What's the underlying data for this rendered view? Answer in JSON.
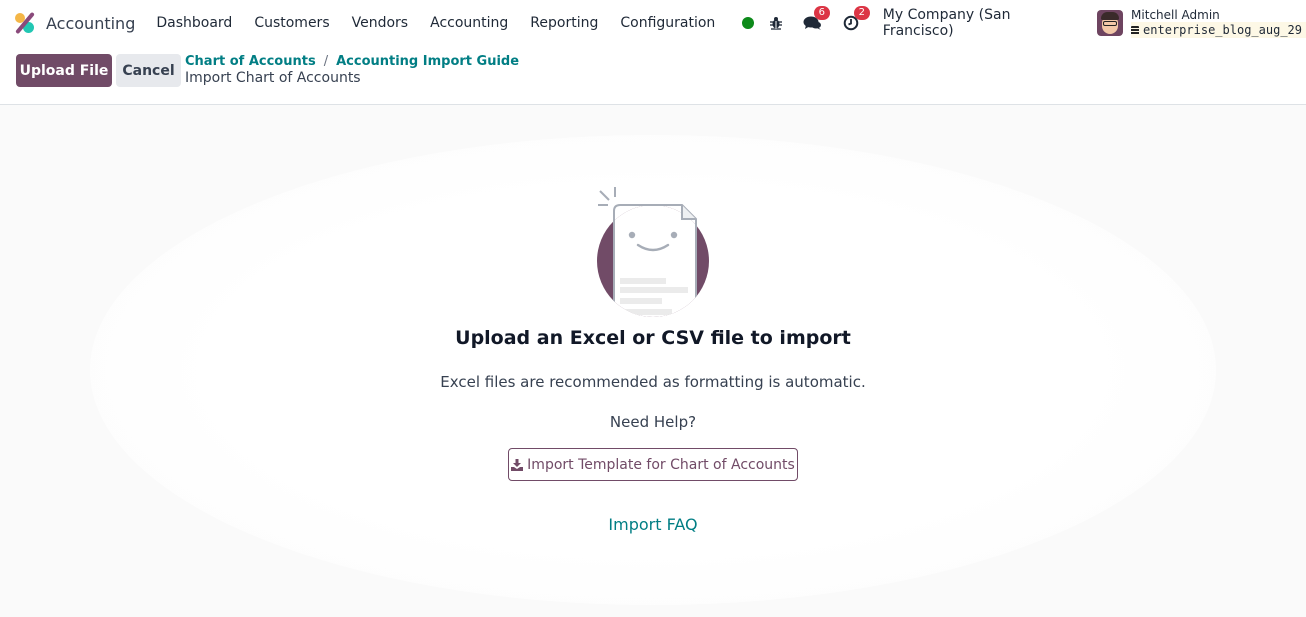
{
  "navbar": {
    "app_name": "Accounting",
    "menu": [
      "Dashboard",
      "Customers",
      "Vendors",
      "Accounting",
      "Reporting",
      "Configuration"
    ],
    "messages_count": "6",
    "activities_count": "2",
    "company": "My Company (San Francisco)",
    "user_name": "Mitchell Admin",
    "database": "enterprise_blog_aug_29",
    "status_color": "#0d8a1a"
  },
  "control_panel": {
    "upload_label": "Upload File",
    "cancel_label": "Cancel",
    "breadcrumbs": [
      "Chart of Accounts",
      "Accounting Import Guide"
    ],
    "breadcrumb_separator": "/",
    "current": "Import Chart of Accounts"
  },
  "main": {
    "title": "Upload an Excel or CSV file to import",
    "subtitle": "Excel files are recommended as formatting is automatic.",
    "help": "Need Help?",
    "template_button": "Import Template for Chart of Accounts",
    "faq_link": "Import FAQ"
  },
  "colors": {
    "brand": "#714b67",
    "link": "#017e84",
    "badge": "#dc3545"
  }
}
